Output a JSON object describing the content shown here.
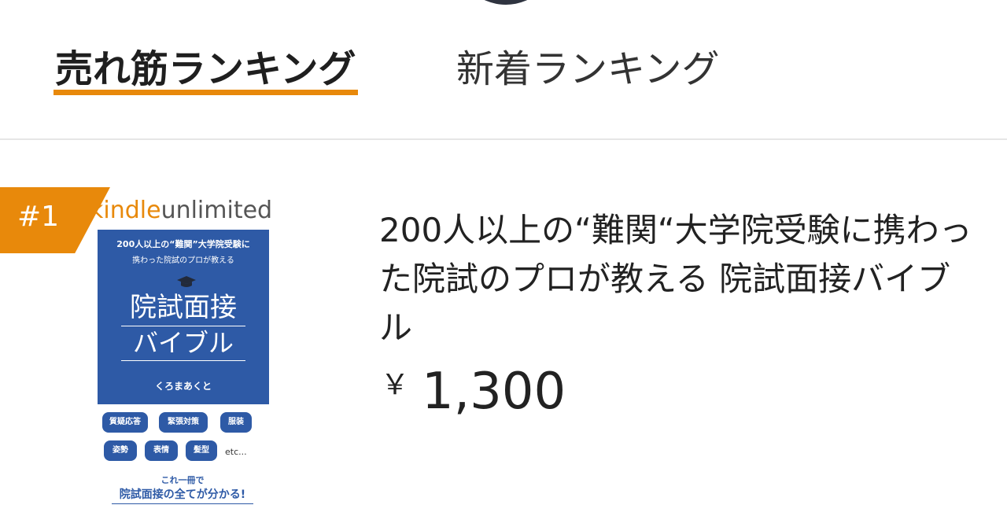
{
  "tabs": {
    "bestseller_label": "売れ筋ランキング",
    "new_label": "新着ランキング",
    "active_color": "#e8890b"
  },
  "item": {
    "rank": "#1",
    "title": "200人以上の“難関“大学院受験に携わった院試のプロが教える 院試面接バイブル",
    "price_symbol": "￥",
    "price_value": "1,300",
    "cover": {
      "logo_kindle": "kindle",
      "logo_unlimited": "unlimited",
      "subtitle_line1": "200人以上の“難関”大学院受験に",
      "subtitle_line2": "携わった院試のプロが教える",
      "title_line1": "院試面接",
      "title_line2": "バイブル",
      "author": "くろまあくと",
      "pills": [
        "質疑応答",
        "緊張対策",
        "服装",
        "姿勢",
        "表情",
        "髪型"
      ],
      "etc": "etc...",
      "tagline1": "これ一冊で",
      "tagline2": "院試面接の全てが分かる!",
      "panel_color": "#2e5aa6"
    }
  }
}
